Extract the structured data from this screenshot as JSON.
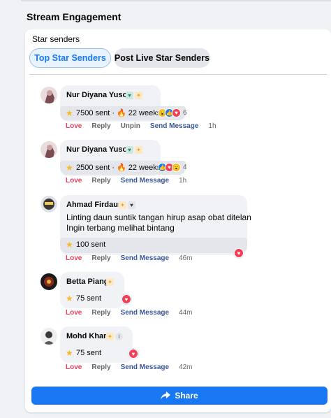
{
  "section_title": "Stream Engagement",
  "card_title": "Star senders",
  "tabs": {
    "top": "Top Star Senders",
    "post": "Post Live Star Senders"
  },
  "comments": [
    {
      "name": "Nur Diyana Yusof",
      "sent": "7500 sent ·",
      "streak": "22 weeks",
      "reaction_count": "6",
      "actions": {
        "love": "Love",
        "reply": "Reply",
        "unpin": "Unpin",
        "send": "Send Message",
        "time": "1h"
      }
    },
    {
      "name": "Nur Diyana Yusof",
      "sent": "2500 sent ·",
      "streak": "22 weeks",
      "reaction_count": "4",
      "actions": {
        "love": "Love",
        "reply": "Reply",
        "send": "Send Message",
        "time": "1h"
      }
    },
    {
      "name": "Ahmad Firdaus",
      "message_line1": "Linting daun suntik tangan hirup asap obat ditelan",
      "message_line2": "Ingin terbang melihat bintang",
      "sent": "100 sent",
      "actions": {
        "love": "Love",
        "reply": "Reply",
        "send": "Send Message",
        "time": "46m"
      }
    },
    {
      "name": "Betta Piang",
      "sent": "75 sent",
      "actions": {
        "love": "Love",
        "reply": "Reply",
        "send": "Send Message",
        "time": "44m"
      }
    },
    {
      "name": "Mohd Khan",
      "sent": "75 sent",
      "actions": {
        "love": "Love",
        "reply": "Reply",
        "send": "Send Message",
        "time": "42m"
      }
    }
  ],
  "share_label": "Share",
  "colors": {
    "accent": "#1877f2",
    "love": "#e4405f",
    "star": "#f7b928"
  }
}
